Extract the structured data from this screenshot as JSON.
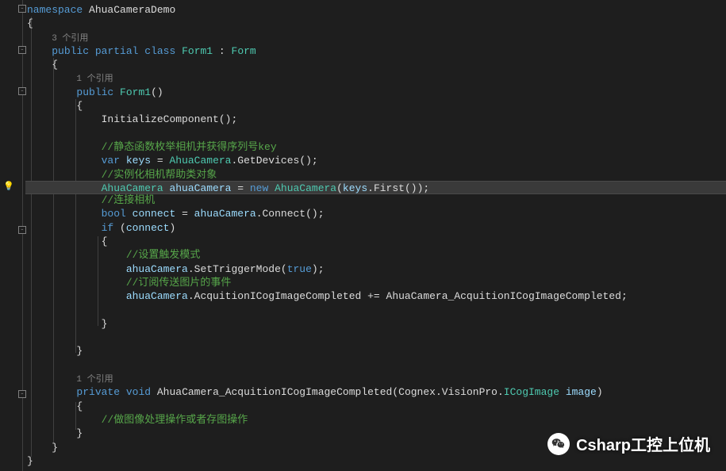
{
  "code": {
    "namespace_kw": "namespace",
    "namespace_name": "AhuaCameraDemo",
    "codelens_3ref": "3 个引用",
    "codelens_1ref_a": "1 个引用",
    "codelens_1ref_b": "1 个引用",
    "public_kw": "public",
    "partial_kw": "partial",
    "class_kw": "class",
    "form1_type": "Form1",
    "colon": " : ",
    "form_type": "Form",
    "ctor_name": "Form1",
    "parens": "()",
    "init_component": "InitializeComponent",
    "comment_static": "//静态函数枚举相机并获得序列号key",
    "var_kw": "var",
    "keys_var": "keys",
    "equals": " = ",
    "ahua_type": "AhuaCamera",
    "get_devices": "GetDevices",
    "comment_instance": "//实例化相机帮助类对象",
    "ahua_var": "ahuaCamera",
    "new_kw": "new",
    "first_method": "First",
    "comment_connect": "//连接相机",
    "bool_kw": "bool",
    "connect_var": "connect",
    "connect_method": "Connect",
    "if_kw": "if",
    "comment_trigger": "//设置触发模式",
    "set_trigger": "SetTriggerMode",
    "true_kw": "true",
    "comment_subscribe": "//订阅传送图片的事件",
    "acq_event": "AcquitionICogImageCompleted",
    "plus_eq": " += ",
    "handler_name": "AhuaCamera_AcquitionICogImageCompleted",
    "private_kw": "private",
    "void_kw": "void",
    "cognex_ns": "Cognex",
    "visionpro_ns": "VisionPro",
    "icogimage_type": "ICogImage",
    "image_param": "image",
    "comment_process": "//做图像处理操作或者存图操作"
  },
  "watermark": {
    "text": "Csharp工控上位机"
  }
}
